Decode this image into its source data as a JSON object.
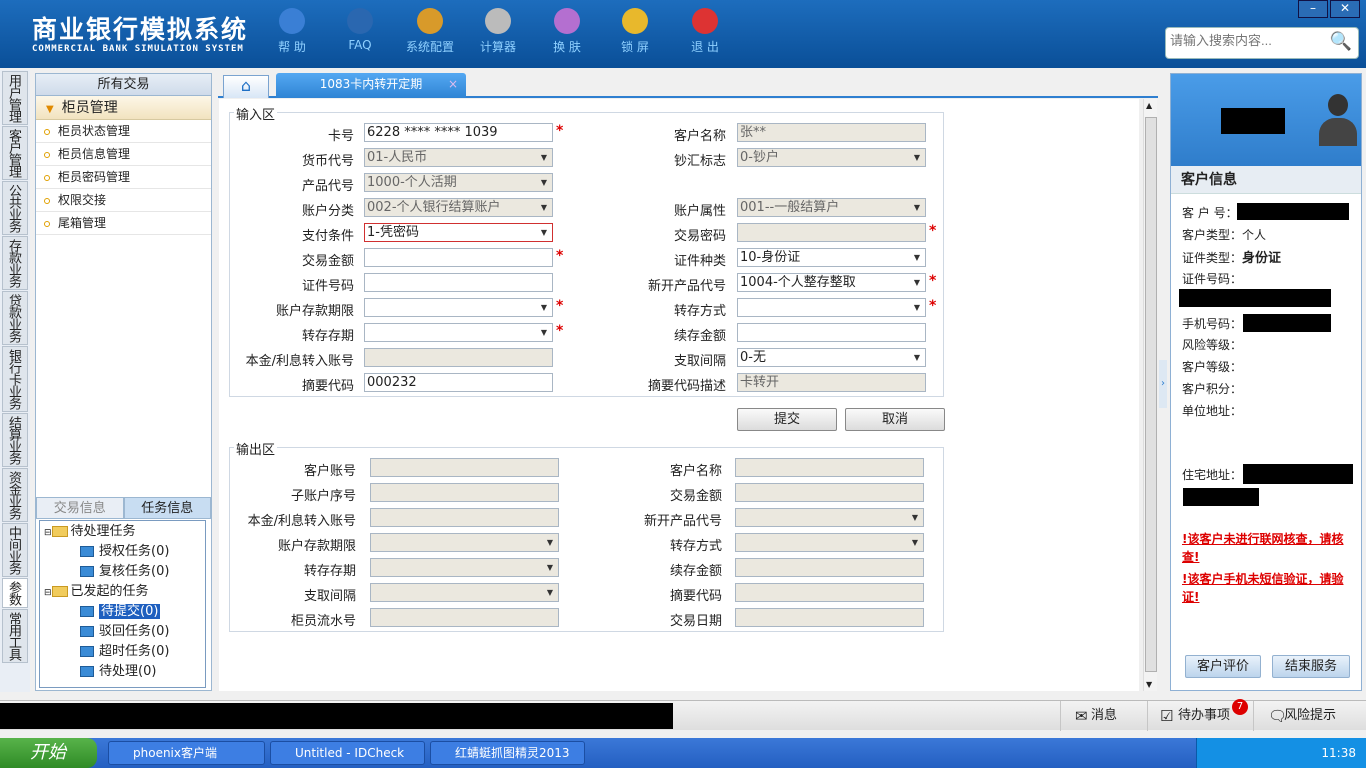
{
  "app": {
    "title_cn": "商业银行模拟系统",
    "title_en": "COMMERCIAL BANK SIMULATION SYSTEM"
  },
  "toolbar": [
    {
      "label": "帮 助",
      "icon": "help-icon",
      "color": "#3a7fd5"
    },
    {
      "label": "FAQ",
      "icon": "faq-icon",
      "color": "#2a67b0"
    },
    {
      "label": "系统配置",
      "icon": "toolbox-icon",
      "color": "#d89a2a"
    },
    {
      "label": "计算器",
      "icon": "calculator-icon",
      "color": "#bbbbbb"
    },
    {
      "label": "换 肤",
      "icon": "shirt-icon",
      "color": "#b46fd0"
    },
    {
      "label": "锁 屏",
      "icon": "lock-icon",
      "color": "#e8b82c"
    },
    {
      "label": "退 出",
      "icon": "power-icon",
      "color": "#d33"
    }
  ],
  "search": {
    "placeholder": "请输入搜索内容..."
  },
  "window": {
    "min": "–",
    "close": "✕"
  },
  "leftnav": [
    "用户管理",
    "客户管理",
    "公共业务",
    "存款业务",
    "贷款业务",
    "银行卡业务",
    "结算业务",
    "资金业务",
    "中间业务",
    "参数",
    "常用工具"
  ],
  "sidebar": {
    "top": "所有交易",
    "group": "柜员管理",
    "items": [
      "柜员状态管理",
      "柜员信息管理",
      "柜员密码管理",
      "权限交接",
      "尾箱管理"
    ],
    "tabs": [
      "交易信息",
      "任务信息"
    ],
    "tree": {
      "pending": "待处理任务",
      "auth": "授权任务(0)",
      "review": "复核任务(0)",
      "initiated": "已发起的任务",
      "tosubmit": "待提交(0)",
      "rejected": "驳回任务(0)",
      "timeout": "超时任务(0)",
      "toprocess": "待处理(0)"
    }
  },
  "tabs": {
    "active": "1083卡内转开定期",
    "close": "×"
  },
  "input_area": {
    "title": "输入区",
    "left": [
      {
        "label": "卡号",
        "value": "6228 **** **** 1039",
        "ro": false,
        "req": true,
        "dd": false
      },
      {
        "label": "货币代号",
        "value": "01-人民币",
        "ro": true,
        "req": false,
        "dd": true
      },
      {
        "label": "产品代号",
        "value": "1000-个人活期",
        "ro": true,
        "req": false,
        "dd": true
      },
      {
        "label": "账户分类",
        "value": "002-个人银行结算账户",
        "ro": true,
        "req": false,
        "dd": true
      },
      {
        "label": "支付条件",
        "value": "1-凭密码",
        "ro": false,
        "req": false,
        "dd": true,
        "err": true
      },
      {
        "label": "交易金额",
        "value": "",
        "ro": false,
        "req": true,
        "dd": false
      },
      {
        "label": "证件号码",
        "value": "",
        "ro": false,
        "req": false,
        "dd": false
      },
      {
        "label": "账户存款期限",
        "value": "",
        "ro": false,
        "req": true,
        "dd": true
      },
      {
        "label": "转存存期",
        "value": "",
        "ro": false,
        "req": true,
        "dd": true
      },
      {
        "label": "本金/利息转入账号",
        "value": "",
        "ro": true,
        "req": false,
        "dd": false
      },
      {
        "label": "摘要代码",
        "value": "000232",
        "ro": false,
        "req": false,
        "dd": false
      }
    ],
    "right": [
      {
        "label": "客户名称",
        "value": "张**",
        "ro": true,
        "req": false,
        "dd": false
      },
      {
        "label": "钞汇标志",
        "value": "0-钞户",
        "ro": true,
        "req": false,
        "dd": true
      },
      {
        "label": "",
        "value": null
      },
      {
        "label": "账户属性",
        "value": "001--一般结算户",
        "ro": true,
        "req": false,
        "dd": true
      },
      {
        "label": "交易密码",
        "value": "",
        "ro": true,
        "req": true,
        "dd": false
      },
      {
        "label": "证件种类",
        "value": "10-身份证",
        "ro": false,
        "req": false,
        "dd": true
      },
      {
        "label": "新开产品代号",
        "value": "1004-个人整存整取",
        "ro": false,
        "req": true,
        "dd": true
      },
      {
        "label": "转存方式",
        "value": "",
        "ro": false,
        "req": true,
        "dd": true
      },
      {
        "label": "续存金额",
        "value": "",
        "ro": false,
        "req": false,
        "dd": false
      },
      {
        "label": "支取间隔",
        "value": "0-无",
        "ro": false,
        "req": false,
        "dd": true
      },
      {
        "label": "摘要代码描述",
        "value": "卡转开",
        "ro": true,
        "req": false,
        "dd": false
      }
    ]
  },
  "buttons": {
    "submit": "提交",
    "cancel": "取消"
  },
  "output_area": {
    "title": "输出区",
    "left": [
      {
        "label": "客户账号",
        "dd": false
      },
      {
        "label": "子账户序号",
        "dd": false
      },
      {
        "label": "本金/利息转入账号",
        "dd": false
      },
      {
        "label": "账户存款期限",
        "dd": true
      },
      {
        "label": "转存存期",
        "dd": true
      },
      {
        "label": "支取间隔",
        "dd": true
      },
      {
        "label": "柜员流水号",
        "dd": false
      }
    ],
    "right": [
      {
        "label": "客户名称",
        "dd": false
      },
      {
        "label": "交易金额",
        "dd": false
      },
      {
        "label": "新开产品代号",
        "dd": true
      },
      {
        "label": "转存方式",
        "dd": true
      },
      {
        "label": "续存金额",
        "dd": false
      },
      {
        "label": "摘要代码",
        "dd": false
      },
      {
        "label": "交易日期",
        "dd": false
      }
    ]
  },
  "customer": {
    "title": "客户信息",
    "no": "客 户 号：",
    "type_label": "客户类型：",
    "type_value": "个人",
    "idtype_label": "证件类型：",
    "idtype_value": "身份证",
    "idno": "证件号码：",
    "phone": "手机号码：",
    "risk": "风险等级：",
    "level": "客户等级：",
    "points": "客户积分：",
    "work": "单位地址：",
    "home": "住宅地址：",
    "warn1": "!该客户未进行联网核查，请核查!",
    "warn2": "!该客户手机未短信验证，请验证!",
    "eval": "客户评价",
    "end": "结束服务"
  },
  "statusbar": {
    "msg": "消息",
    "todo": "待办事项",
    "todo_count": "7",
    "risk": "风险提示"
  },
  "taskbar": {
    "start": "开始",
    "items": [
      "phoenix客户端",
      "Untitled - IDCheck",
      "红蜻蜓抓图精灵2013"
    ],
    "time": "11:38"
  }
}
